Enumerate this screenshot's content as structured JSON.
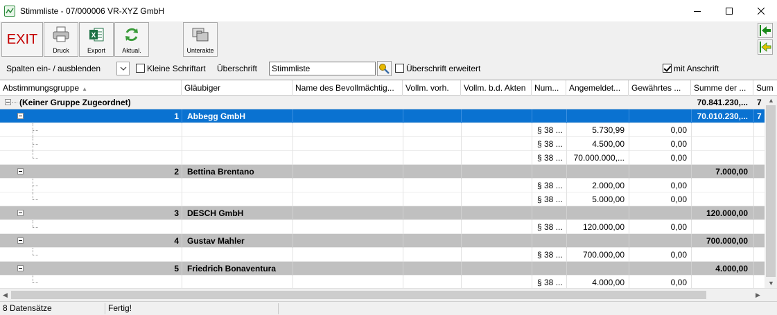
{
  "window": {
    "title": "Stimmliste - 07/000006 VR-XYZ GmbH"
  },
  "toolbar": {
    "exit_label": "EXIT",
    "print_label": "Druck",
    "export_label": "Export",
    "refresh_label": "Aktual.",
    "subfile_label": "Unterakte"
  },
  "options": {
    "columns_label": "Spalten ein- / ausblenden",
    "small_font_label": "Kleine Schriftart",
    "small_font_checked": false,
    "heading_label": "Überschrift",
    "heading_value": "Stimmliste",
    "heading_extended_label": "Überschrift erweitert",
    "heading_extended_checked": false,
    "with_address_label": "mit Anschrift",
    "with_address_checked": true
  },
  "table": {
    "columns": [
      "Abstimmungsgruppe",
      "Gläubiger",
      "Name des Bevollmächtig...",
      "Vollm. vorh.",
      "Vollm. b.d. Akten",
      "Num...",
      "Angemeldet...",
      "Gewährtes ...",
      "Summe der ...",
      "Sum"
    ],
    "top_group": {
      "label": "(Keiner Gruppe Zugeordnet)",
      "sum": "70.841.230,...",
      "sum2": "7"
    },
    "groups": [
      {
        "number": "1",
        "creditor": "Abbegg GmbH",
        "sum": "70.010.230,...",
        "sum2": "7",
        "selected": true,
        "items": [
          {
            "num": "§ 38 ...",
            "registered": "5.730,99",
            "granted": "0,00"
          },
          {
            "num": "§ 38 ...",
            "registered": "4.500,00",
            "granted": "0,00"
          },
          {
            "num": "§ 38 ...",
            "registered": "70.000.000,...",
            "granted": "0,00"
          }
        ]
      },
      {
        "number": "2",
        "creditor": "Bettina Brentano",
        "sum": "7.000,00",
        "sum2": "",
        "selected": false,
        "items": [
          {
            "num": "§ 38 ...",
            "registered": "2.000,00",
            "granted": "0,00"
          },
          {
            "num": "§ 38 ...",
            "registered": "5.000,00",
            "granted": "0,00"
          }
        ]
      },
      {
        "number": "3",
        "creditor": "DESCH GmbH",
        "sum": "120.000,00",
        "sum2": "",
        "selected": false,
        "items": [
          {
            "num": "§ 38 ...",
            "registered": "120.000,00",
            "granted": "0,00"
          }
        ]
      },
      {
        "number": "4",
        "creditor": "Gustav Mahler",
        "sum": "700.000,00",
        "sum2": "",
        "selected": false,
        "items": [
          {
            "num": "§ 38 ...",
            "registered": "700.000,00",
            "granted": "0,00"
          }
        ]
      },
      {
        "number": "5",
        "creditor": "Friedrich Bonaventura",
        "sum": "4.000,00",
        "sum2": "",
        "selected": false,
        "items": [
          {
            "num": "§ 38 ...",
            "registered": "4.000,00",
            "granted": "0,00"
          }
        ]
      }
    ]
  },
  "status": {
    "records": "8 Datensätze",
    "state": "Fertig!"
  },
  "colors": {
    "selection": "#0a72d1",
    "group_row": "#c0c0c0",
    "exit_text": "#c40000"
  }
}
